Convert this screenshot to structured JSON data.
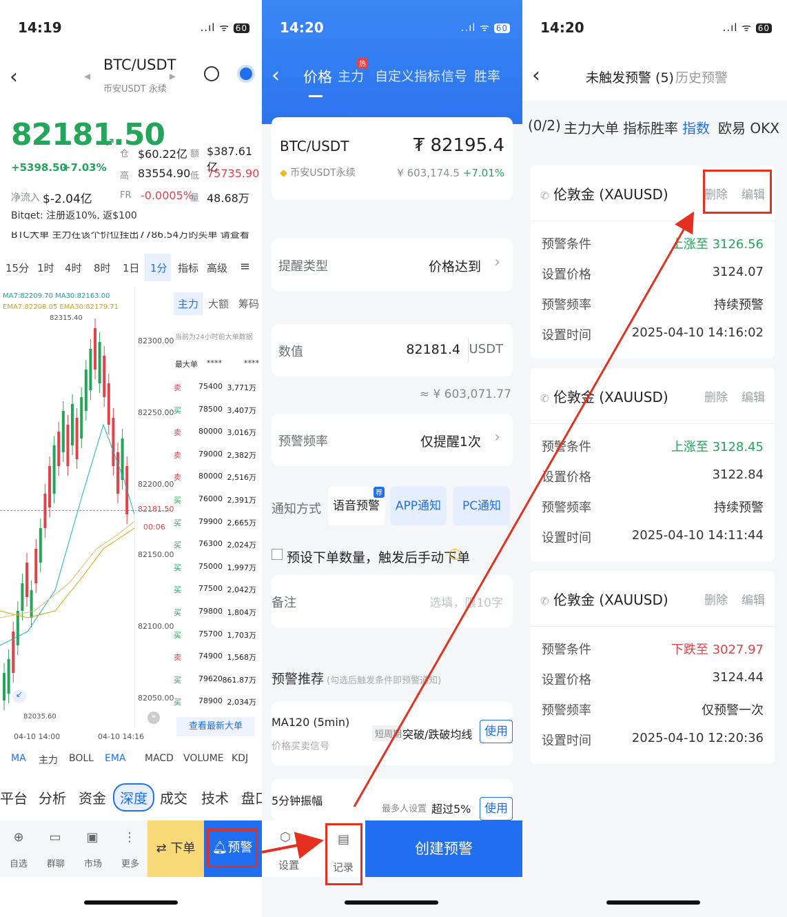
{
  "panel1": {
    "time": "14:19",
    "signal": "..ıl ᯤ",
    "battery": "60",
    "pair": "BTC/USDT",
    "pair_sub": "币安USDT 永续",
    "price": "82181.50",
    "change_abs": "+5398.50",
    "change_pct": "+7.03%",
    "cap_label": "仓",
    "cap_value": "$60.22亿",
    "vol_label": "额",
    "vol_value": "$387.61亿",
    "high_label": "高",
    "high_value": "83554.90",
    "low_label": "低",
    "low_value": "75735.90",
    "inflow_label": "净流入",
    "inflow_value": "$-2.04亿",
    "fr_label": "FR",
    "fr_value": "-0.0005%",
    "qty_label": "量",
    "qty_value": "48.68万",
    "ticker1": "Bitget: 注册返10%, 返$100",
    "ticker2": "BTC大单  主力在该个价位挂出7786.54万的买单  请查看",
    "intervals": [
      "15分",
      "1时",
      "4时",
      "8时",
      "1日",
      "1分",
      "指标",
      "高级"
    ],
    "ma_line1": "MA7:82209.70 MA30:82163.00",
    "ema_line": "EMA7:82208.05 EMA30:82179.71",
    "high_mark": "82315.40",
    "low_mark": "82035.60",
    "yticks": [
      "82300.00",
      "82250.00",
      "82200.00",
      "82150.00",
      "82100.00",
      "82050.00"
    ],
    "cur_price_tag": "82181.50",
    "cur_time_tag": "00:06",
    "xticks": [
      "04-10 14:00",
      "04-10 14:16"
    ],
    "side_tabs": [
      "主力",
      "大额",
      "筹码"
    ],
    "side_note": "当前为24小时前大单数据",
    "side_header": [
      "最大单",
      "****",
      "****"
    ],
    "trades": [
      {
        "side": "卖",
        "price": "75400",
        "amt": "3,771万"
      },
      {
        "side": "买",
        "price": "78500",
        "amt": "3,407万"
      },
      {
        "side": "卖",
        "price": "80000",
        "amt": "3,016万"
      },
      {
        "side": "卖",
        "price": "79000",
        "amt": "2,382万"
      },
      {
        "side": "卖",
        "price": "80000",
        "amt": "2,516万"
      },
      {
        "side": "买",
        "price": "76000",
        "amt": "2,391万"
      },
      {
        "side": "买",
        "price": "79900",
        "amt": "2,665万"
      },
      {
        "side": "买",
        "price": "76300",
        "amt": "2,024万"
      },
      {
        "side": "买",
        "price": "75000",
        "amt": "1,997万"
      },
      {
        "side": "买",
        "price": "77500",
        "amt": "2,042万"
      },
      {
        "side": "买",
        "price": "79800",
        "amt": "1,804万"
      },
      {
        "side": "买",
        "price": "75700",
        "amt": "1,703万"
      },
      {
        "side": "卖",
        "price": "74900",
        "amt": "1,568万"
      },
      {
        "side": "买",
        "price": "79620",
        "amt": "861.87万"
      },
      {
        "side": "买",
        "price": "78900",
        "amt": "2,034万"
      }
    ],
    "view_latest": "查看最新大单",
    "ind_tabs": [
      "MA",
      "主力",
      "BOLL",
      "EMA",
      "MACD",
      "VOLUME",
      "KDJ"
    ],
    "bottom_tabs": [
      "平台",
      "分析",
      "资金",
      "深度",
      "成交",
      "技术",
      "盘口"
    ],
    "nav": [
      "自选",
      "群聊",
      "市场",
      "更多"
    ],
    "order_btn": "下单",
    "alert_btn": "预警"
  },
  "panel2": {
    "time": "14:20",
    "signal": "..ıl ᯤ",
    "battery": "60",
    "tabs": [
      "价格",
      "主力",
      "自定义指标",
      "信号",
      "胜率"
    ],
    "hot_badge": "热",
    "pair": "BTC/USDT",
    "pair_sub": "币安USDT永续",
    "price": "82195.4",
    "price_cny": "¥ 603,174.5",
    "price_pct": "+7.01%",
    "remind_type_label": "提醒类型",
    "remind_type_value": "价格达到",
    "value_label": "数值",
    "value_input": "82181.4",
    "value_unit": "USDT",
    "value_cny": "≈ ¥ 603,071.77",
    "freq_label": "预警频率",
    "freq_value": "仅提醒1次",
    "notify_label": "通知方式",
    "notify_opts": [
      "语音预警",
      "APP通知",
      "PC通知"
    ],
    "rec_badge": "荐",
    "preorder_text": "预设下单数量，触发后手动下单",
    "note_label": "备注",
    "note_placeholder": "选填，限10字",
    "rec_title": "预警推荐",
    "rec_sub": "(勾选后触发条件即预警通知)",
    "rec1_title": "MA120 (5min)",
    "rec1_sub": "价格买卖信号",
    "rec1_tag": "短周期",
    "rec1_desc": "突破/跌破均线",
    "use_label": "使用",
    "rec2_title": "5分钟振幅",
    "rec2_tag": "最多人设置",
    "rec2_desc": "超过5%",
    "nav_settings": "设置",
    "nav_record": "记录",
    "create_btn": "创建预警"
  },
  "panel3": {
    "time": "14:20",
    "signal": "..ıl ᯤ",
    "battery": "60",
    "tab_active": "未触发预警 (5)",
    "tab_history": "历史预警",
    "filters": [
      "(0/2)",
      "主力大单",
      "指标胜率",
      "指数",
      "欧易 OKX"
    ],
    "delete_label": "删除",
    "edit_label": "编辑",
    "alerts": [
      {
        "name": "伦敦金 (XAUUSD)",
        "cond_label": "预警条件",
        "cond": "上涨至 3126.56",
        "set_label": "设置价格",
        "set": "3124.07",
        "freq_label": "预警频率",
        "freq": "持续预警",
        "time_label": "设置时间",
        "time": "2025-04-10 14:16:02",
        "dir": "up"
      },
      {
        "name": "伦敦金 (XAUUSD)",
        "cond_label": "预警条件",
        "cond": "上涨至 3128.45",
        "set_label": "设置价格",
        "set": "3122.84",
        "freq_label": "预警频率",
        "freq": "持续预警",
        "time_label": "设置时间",
        "time": "2025-04-10 14:11:44",
        "dir": "up"
      },
      {
        "name": "伦敦金 (XAUUSD)",
        "cond_label": "预警条件",
        "cond": "下跌至 3027.97",
        "set_label": "设置价格",
        "set": "3124.44",
        "freq_label": "预警频率",
        "freq": "仅预警一次",
        "time_label": "设置时间",
        "time": "2025-04-10 12:20:36",
        "dir": "down"
      }
    ]
  },
  "colors": {
    "up": "#23a55a",
    "down": "#e2424a",
    "brand": "#1f6ff0",
    "annot": "#e53020"
  }
}
